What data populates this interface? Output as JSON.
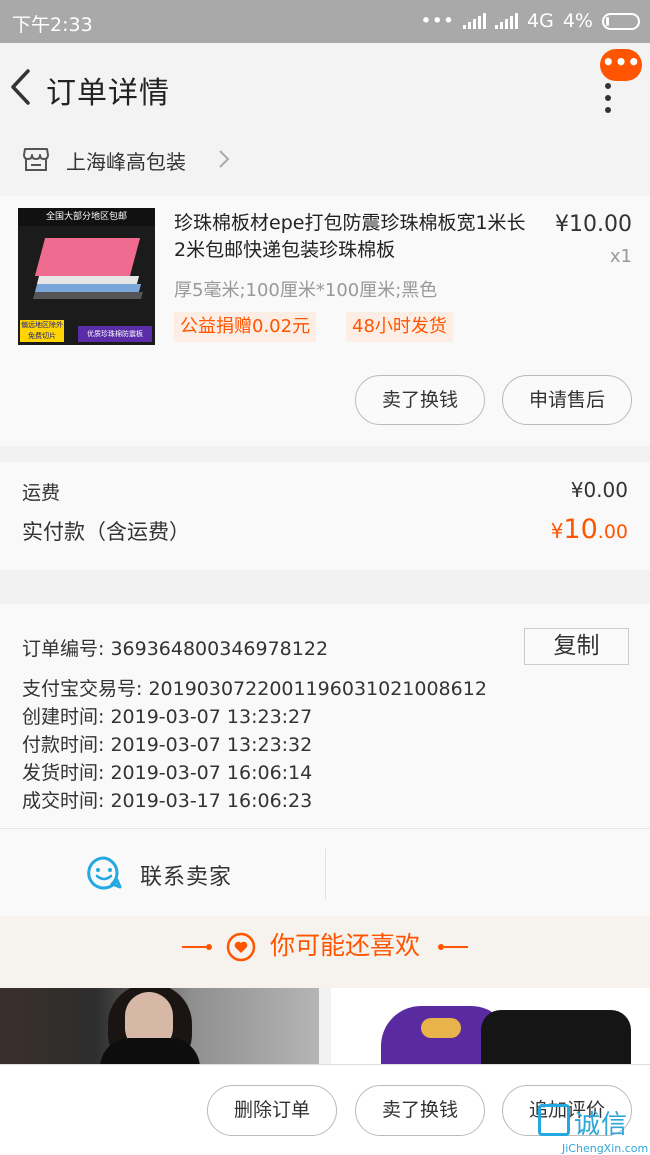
{
  "status_bar": {
    "time": "下午2:33",
    "network": "4G",
    "battery": "4%"
  },
  "navbar": {
    "title": "订单详情",
    "badge": "•••"
  },
  "shop": {
    "name": "上海峰高包装"
  },
  "product": {
    "title": "珍珠棉板材epe打包防震珍珠棉板宽1米长2米包邮快递包装珍珠棉板",
    "price": "¥10.00",
    "qty": "x1",
    "spec": "厚5毫米;100厘米*100厘米;黑色",
    "tags": [
      "公益捐赠0.02元",
      "48小时发货"
    ],
    "thumb_text": {
      "top": "全国大部分地区包邮",
      "badge_left": "偏远地区除外 免费切片",
      "badge_right": "优质珍珠棉防震板"
    },
    "buttons": {
      "sell": "卖了换钱",
      "after_sale": "申请售后"
    }
  },
  "fees": {
    "shipping_label": "运费",
    "shipping_value": "¥0.00",
    "paid_label": "实付款（含运费）",
    "paid_currency": "¥",
    "paid_int": "10",
    "paid_dec": ".00"
  },
  "order_info": {
    "order_no": "订单编号:   369364800346978122",
    "alipay_no": "支付宝交易号:   2019030722001196031021008612",
    "created": "创建时间:   2019-03-07 13:23:27",
    "paid": "付款时间:   2019-03-07 13:23:32",
    "shipped": "发货时间:   2019-03-07 16:06:14",
    "completed": "成交时间:   2019-03-17 16:06:23",
    "copy_label": "复制"
  },
  "contact": {
    "label": "联系卖家"
  },
  "recommend": {
    "title": "你可能还喜欢"
  },
  "bottom_bar": {
    "delete": "删除订单",
    "sell": "卖了换钱",
    "review": "追加评价"
  },
  "watermark": {
    "text": "诚信",
    "sub": "JiChengXin.com"
  },
  "colors": {
    "accent": "#ff5500",
    "status_bar": "#a9a9a9",
    "contact_icon": "#23a9e1"
  }
}
